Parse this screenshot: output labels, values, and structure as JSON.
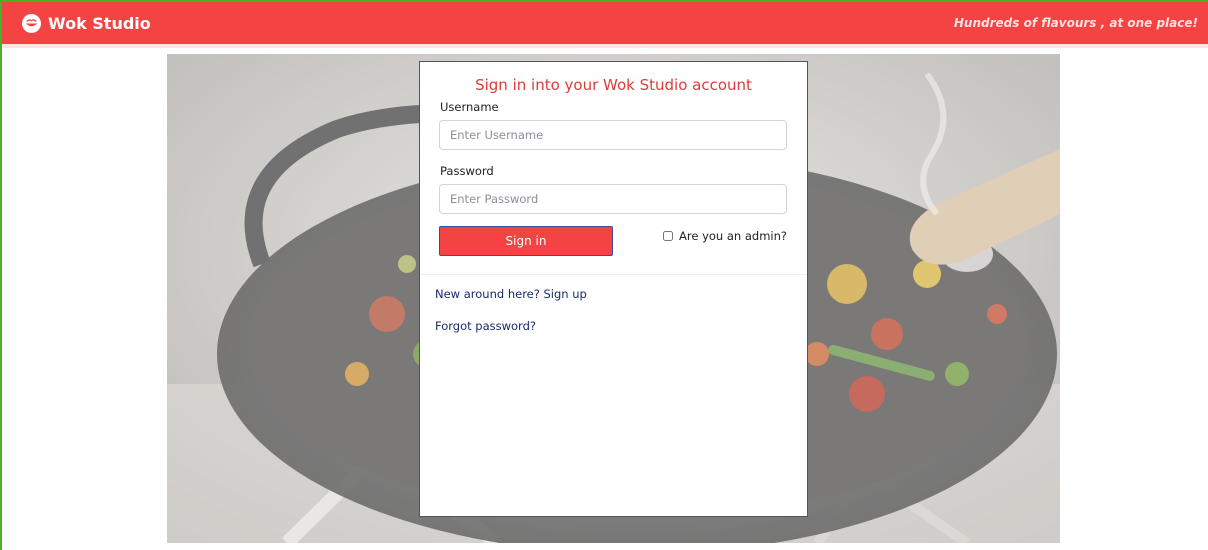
{
  "navbar": {
    "brand_name": "Wok Studio",
    "tagline": "Hundreds of flavours , at one place!",
    "logo_icon": "wok-logo-icon",
    "bg_color": "#f44343"
  },
  "login": {
    "title": "Sign in into your Wok Studio account",
    "username_label": "Username",
    "username_placeholder": "Enter Username",
    "username_value": "",
    "password_label": "Password",
    "password_placeholder": "Enter Password",
    "password_value": "",
    "signin_label": "Sign in",
    "admin_label": "Are you an admin?",
    "admin_checked": false,
    "signup_link": "New around here? Sign up",
    "forgot_link": "Forgot password?"
  }
}
